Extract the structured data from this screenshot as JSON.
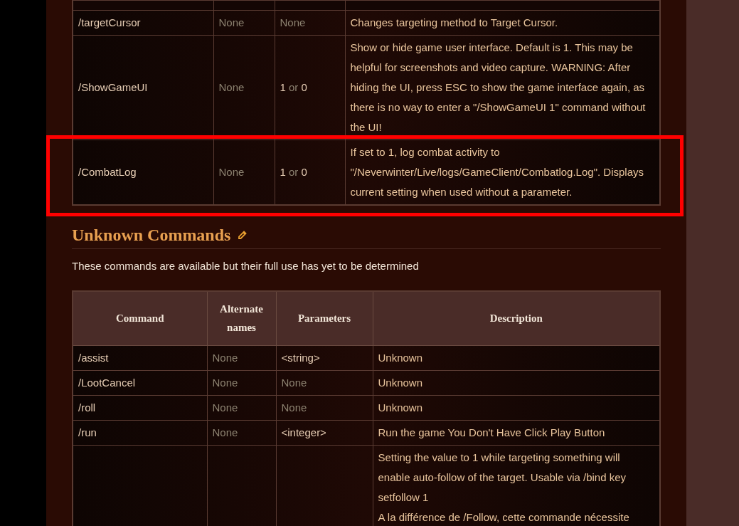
{
  "commands_table": {
    "rows": [
      {
        "command": "/targetCursor",
        "alternate": [
          {
            "text": "None",
            "muted": true
          }
        ],
        "parameters": [
          {
            "text": "None",
            "muted": true
          }
        ],
        "description": [
          "Changes targeting method to Target Cursor."
        ]
      },
      {
        "command": "/ShowGameUI",
        "alternate": [
          {
            "text": "None",
            "muted": true
          }
        ],
        "parameters": [
          {
            "text": "1",
            "muted": false
          },
          {
            "text": "or",
            "muted": true
          },
          {
            "text": "0",
            "muted": false
          }
        ],
        "description": [
          "Show or hide game user interface. Default is 1. This may be helpful for screenshots and video capture. WARNING: After hiding the UI, press ESC to show the game interface again, as there is no way to enter a \"/ShowGameUI 1\" command without the UI!"
        ]
      },
      {
        "command": "/CombatLog",
        "alternate": [
          {
            "text": "None",
            "muted": true
          }
        ],
        "parameters": [
          {
            "text": "1",
            "muted": false
          },
          {
            "text": "or",
            "muted": true
          },
          {
            "text": "0",
            "muted": false
          }
        ],
        "description": [
          "If set to 1, log combat activity to \"/Neverwinter/Live/logs/GameClient/Combatlog.Log\". Displays current setting when used without a parameter."
        ],
        "highlighted": true
      }
    ]
  },
  "unknown_section": {
    "heading": "Unknown Commands",
    "intro": "These commands are available but their full use has yet to be determined",
    "table": {
      "columns": [
        "Command",
        "Alternate names",
        "Parameters",
        "Description"
      ],
      "rows": [
        {
          "command": "/assist",
          "alternate": [
            {
              "text": "None",
              "muted": true
            }
          ],
          "parameters": [
            {
              "text": "<string>",
              "muted": false
            }
          ],
          "description": [
            "Unknown"
          ]
        },
        {
          "command": "/LootCancel",
          "alternate": [
            {
              "text": "None",
              "muted": true
            }
          ],
          "parameters": [
            {
              "text": "None",
              "muted": true
            }
          ],
          "description": [
            "Unknown"
          ]
        },
        {
          "command": "/roll",
          "alternate": [
            {
              "text": "None",
              "muted": true
            }
          ],
          "parameters": [
            {
              "text": "None",
              "muted": true
            }
          ],
          "description": [
            "Unknown"
          ]
        },
        {
          "command": "/run",
          "alternate": [
            {
              "text": "None",
              "muted": true
            }
          ],
          "parameters": [
            {
              "text": "<integer>",
              "muted": false
            }
          ],
          "description": [
            "Run the game You Don't Have Click Play Button"
          ]
        },
        {
          "description": [
            "Setting the value to 1 while targeting something will enable auto-follow of the target. Usable via /bind key setfollow 1",
            "A la différence de /Follow, cette commande nécessite"
          ]
        }
      ]
    }
  }
}
